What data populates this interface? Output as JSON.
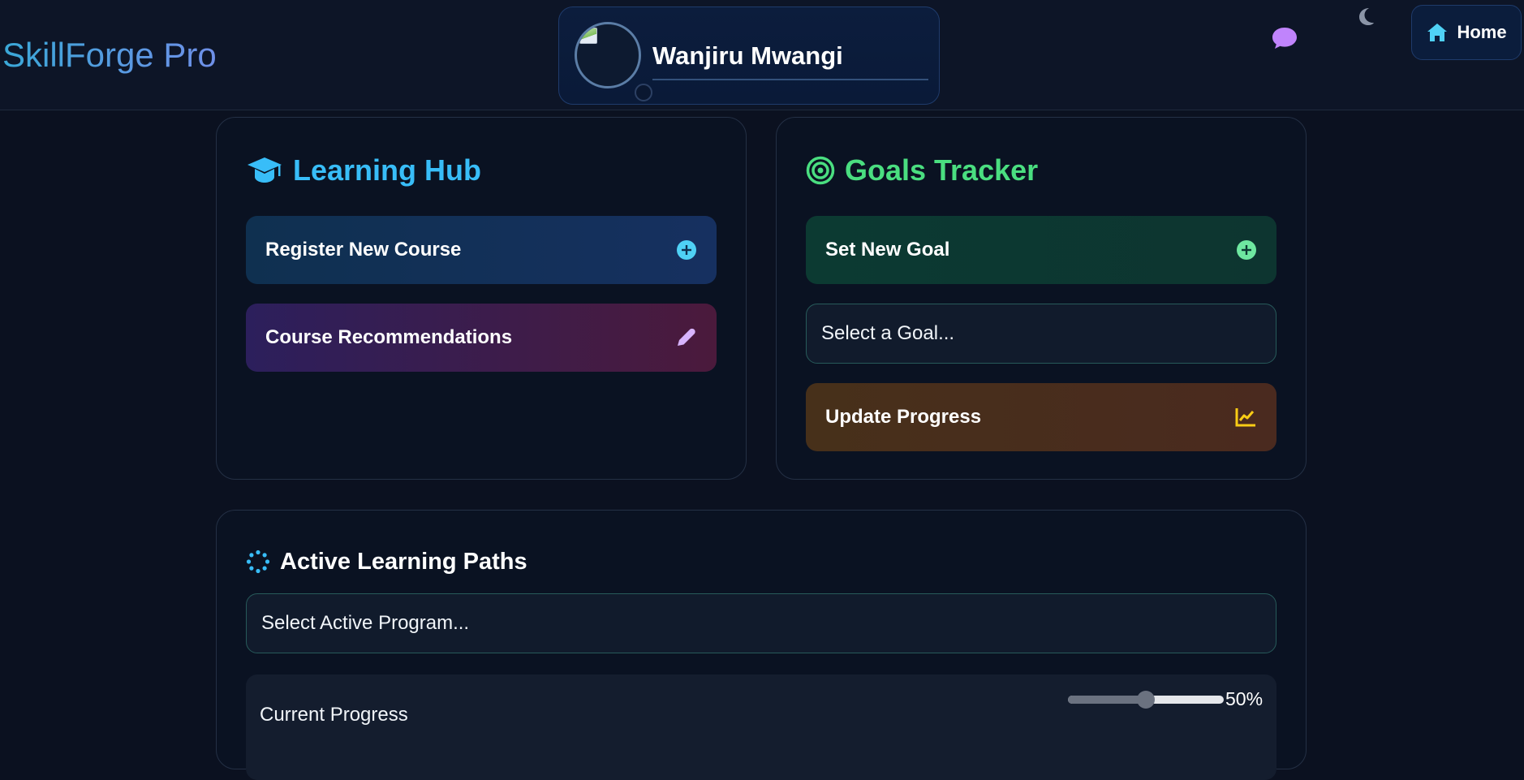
{
  "header": {
    "brand": "SkillForge Pro",
    "profile_name": "Wanjiru Mwangi",
    "home_label": "Home"
  },
  "learning_hub": {
    "title": "Learning Hub",
    "register_label": "Register New Course",
    "recommend_label": "Course Recommendations"
  },
  "goals_tracker": {
    "title": "Goals Tracker",
    "set_goal_label": "Set New Goal",
    "select_goal_value": "Select a Goal...",
    "update_label": "Update Progress"
  },
  "active_paths": {
    "title": "Active Learning Paths",
    "select_program_value": "Select Active Program...",
    "progress_label": "Current Progress",
    "progress_value": "50%",
    "progress_fraction": 0.5
  },
  "colors": {
    "background": "#0b1120",
    "learning_accent": "#38bdf8",
    "goals_accent": "#4ade80",
    "chat_icon": "#c084fc",
    "update_icon": "#facc15",
    "recommend_icon": "#d8b4fe"
  },
  "icons": {
    "chat": "chat-bubble-icon",
    "theme": "moon-icon",
    "home": "home-icon",
    "learning": "graduation-cap-icon",
    "goals": "target-icon",
    "paths": "spinner-icon",
    "register": "plus-circle-icon",
    "recommend": "pencil-icon",
    "set_goal": "plus-circle-icon",
    "update": "line-chart-icon"
  }
}
